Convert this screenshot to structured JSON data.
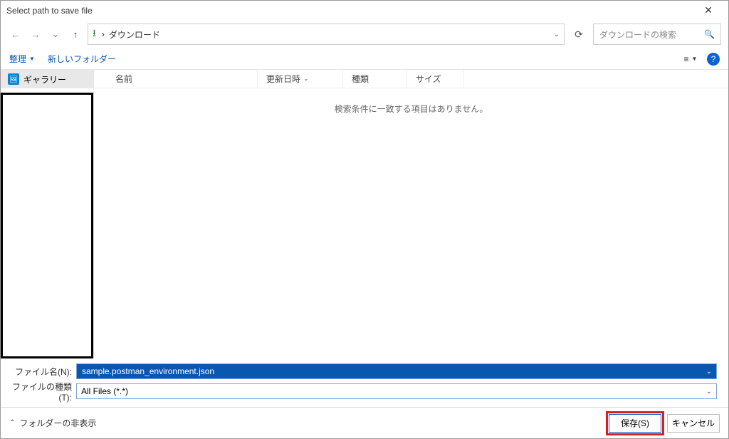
{
  "title": "Select path to save file",
  "nav": {
    "path_folder": "ダウンロード",
    "search_placeholder": "ダウンロードの検索"
  },
  "toolbar": {
    "organize": "整理",
    "new_folder": "新しいフォルダー"
  },
  "sidebar": {
    "gallery": "ギャラリー"
  },
  "columns": {
    "name": "名前",
    "date": "更新日時",
    "type": "種類",
    "size": "サイズ"
  },
  "empty_message": "検索条件に一致する項目はありません。",
  "fields": {
    "filename_label": "ファイル名(N):",
    "filename_value": "sample.postman_environment.json",
    "filetype_label": "ファイルの種類(T):",
    "filetype_value": "All Files (*.*)"
  },
  "bottom": {
    "hide_folders": "フォルダーの非表示",
    "save": "保存(S)",
    "cancel": "キャンセル"
  },
  "help_glyph": "?"
}
